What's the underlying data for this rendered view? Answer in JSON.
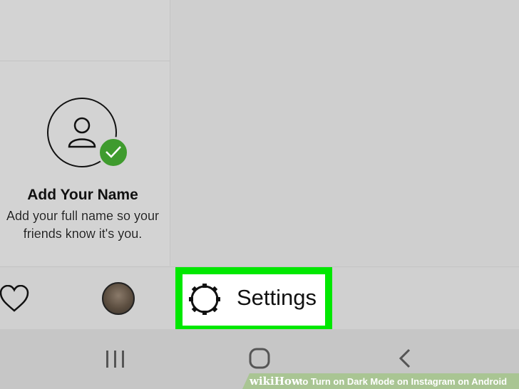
{
  "profile_card": {
    "title": "Add Your Name",
    "description_line1": "Add your full name so your",
    "description_line2": "friends know it's you."
  },
  "settings_button": {
    "label": "Settings"
  },
  "watermark": {
    "brand": "wiki",
    "brand_bold": "How",
    "caption": "to Turn on Dark Mode on Instagram on Android"
  },
  "colors": {
    "highlight": "#00e800",
    "check_badge": "#3f9b2e",
    "background": "#cfcfcf"
  },
  "icons": {
    "avatar": "person-outline-icon",
    "badge": "checkmark-icon",
    "heart": "heart-icon",
    "settings": "gear-icon",
    "nav_recent": "recent-apps-icon",
    "nav_home": "home-icon",
    "nav_back": "back-icon"
  }
}
